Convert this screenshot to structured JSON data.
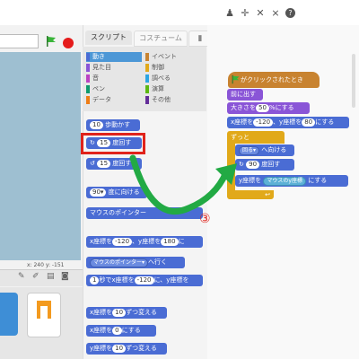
{
  "menubar": {
    "icons": [
      "stamp-icon",
      "expand-icon",
      "shrink-icon",
      "fullscreen-icon",
      "help-icon"
    ]
  },
  "stage": {
    "coords": "x: 240  y: -151"
  },
  "palette": {
    "tabs": {
      "scripts": "スクリプト",
      "costumes": "コスチューム"
    },
    "categories": [
      {
        "label": "動き",
        "color": "#4a6cd4",
        "active": true
      },
      {
        "label": "見た目",
        "color": "#8a55d7"
      },
      {
        "label": "音",
        "color": "#bb42c3"
      },
      {
        "label": "ペン",
        "color": "#0e9a6c"
      },
      {
        "label": "データ",
        "color": "#ee7d16"
      },
      {
        "label": "イベント",
        "color": "#c88330"
      },
      {
        "label": "制御",
        "color": "#e1a91a"
      },
      {
        "label": "調べる",
        "color": "#2ca5e2"
      },
      {
        "label": "演算",
        "color": "#5cb712"
      },
      {
        "label": "その他",
        "color": "#632d99"
      }
    ],
    "blocks": {
      "move": {
        "num": "10",
        "text": "歩動かす"
      },
      "turn_right": {
        "num": "15",
        "text": "度回す"
      },
      "turn_left": {
        "num": "15",
        "text": "度回す"
      },
      "point_direction": {
        "num": "90▾",
        "text": "度に向ける"
      },
      "point_towards": {
        "text": "マウスのポインター"
      },
      "goto_xy": {
        "t1": "x座標を",
        "x": "-120",
        "t2": "、y座標を",
        "y": "180",
        "t3": "に"
      },
      "goto": {
        "text": "マウスのポインター▾",
        "t2": "へ行く"
      },
      "glide": {
        "num": "1",
        "t1": "秒でx座標を",
        "x": "-120",
        "t2": "に、y座標を"
      },
      "change_x": {
        "t1": "x座標を",
        "num": "10",
        "t2": "ずつ変える"
      },
      "set_x": {
        "t1": "x座標を",
        "num": "0",
        "t2": "にする"
      },
      "change_y": {
        "t1": "y座標を",
        "num": "10",
        "t2": "ずつ変える"
      }
    }
  },
  "script": {
    "hat": "がクリックされたとき",
    "front": "前に出す",
    "size": {
      "t1": "大きさを",
      "num": "50",
      "t2": "%にする"
    },
    "goto_xy": {
      "t1": "x座標を",
      "x": "-120",
      "t2": "、y座標を",
      "y": "80",
      "t3": "にする"
    },
    "forever": "ずっと",
    "point_towards": {
      "oval": "回る▾",
      "t2": "へ向ける"
    },
    "turn": {
      "num": "90",
      "t2": "度回す"
    },
    "set_y": {
      "t1": "y座標を",
      "oval": "マウスのy座標",
      "t2": "にする"
    }
  },
  "annotation": {
    "label": "③",
    "arrow_color": "#22aa44",
    "highlight_color": "#e0231b"
  }
}
